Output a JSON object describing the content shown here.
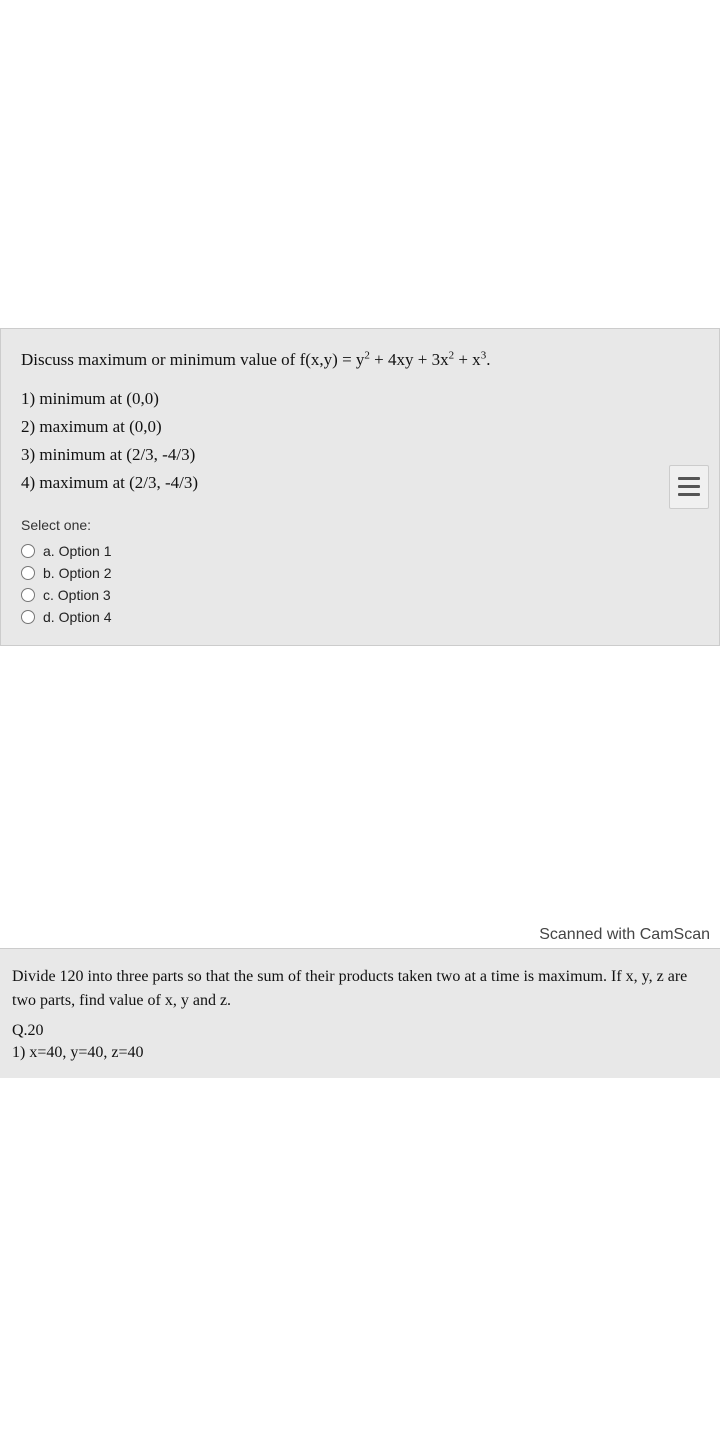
{
  "top_spacer_height": 328,
  "question_card": {
    "question": "Discuss maximum or minimum value of f(x,y) = y² + 4xy + 3x² + x³.",
    "question_parts": {
      "prefix": "Discuss maximum or minimum value of f(x,y) = y",
      "y_exp": "2",
      "middle": " + 4xy + 3x",
      "x_exp": "2",
      "suffix": " + x",
      "x_exp3": "3",
      "end": "."
    },
    "options": [
      "1) minimum at (0,0)",
      "2) maximum at (0,0)",
      "3) minimum at (2/3, -4/3)",
      "4) maximum at (2/3, -4/3)"
    ],
    "select_label": "Select one:",
    "radio_options": [
      {
        "id": "opt_a",
        "label": "a. Option 1"
      },
      {
        "id": "opt_b",
        "label": "b. Option 2"
      },
      {
        "id": "opt_c",
        "label": "c. Option 3"
      },
      {
        "id": "opt_d",
        "label": "d. Option 4"
      }
    ],
    "menu_icon_label": "menu"
  },
  "watermark": "Scanned with CamScan",
  "bottom_section": {
    "text": "Divide 120 into three parts so that the sum of their products taken two at a time is maximum. If x, y, z are two parts, find value of x, y and z.",
    "q_label": "Q.20",
    "answer_line": "1) x=40, y=40, z=40"
  }
}
